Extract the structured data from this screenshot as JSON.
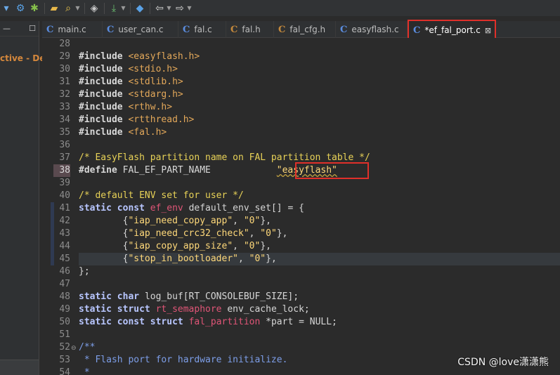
{
  "toolbar": {
    "icons": [
      "refresh-icon",
      "settings-icon",
      "debug-icon",
      "new-folder-icon",
      "search-icon",
      "layers-icon",
      "download-icon",
      "stack-icon",
      "back-icon",
      "forward-icon"
    ]
  },
  "left_panel": {
    "header_icons": [
      "minimize-icon",
      "maximize-icon"
    ],
    "project_label_fragment": "ctive - De"
  },
  "tabs": [
    {
      "label": "main.c",
      "icon": "C",
      "icon_color": "#5b8de0",
      "modified": false,
      "active": false
    },
    {
      "label": "user_can.c",
      "icon": "C",
      "icon_color": "#5b8de0",
      "modified": false,
      "active": false
    },
    {
      "label": "fal.c",
      "icon": "C",
      "icon_color": "#5b8de0",
      "modified": false,
      "active": false
    },
    {
      "label": "fal.h",
      "icon": "C",
      "icon_color": "#c58a3c",
      "modified": false,
      "active": false
    },
    {
      "label": "fal_cfg.h",
      "icon": "C",
      "icon_color": "#c58a3c",
      "modified": false,
      "active": false
    },
    {
      "label": "easyflash.c",
      "icon": "C",
      "icon_color": "#5b8de0",
      "modified": false,
      "active": false
    },
    {
      "label": "*ef_fal_port.c",
      "icon": "C",
      "icon_color": "#5b8de0",
      "modified": true,
      "active": true,
      "close": "⊠"
    }
  ],
  "editor": {
    "line_numbers": [
      "28",
      "29",
      "30",
      "31",
      "32",
      "33",
      "34",
      "35",
      "36",
      "37",
      "38",
      "39",
      "40",
      "41",
      "42",
      "43",
      "44",
      "45",
      "46",
      "47",
      "48",
      "49",
      "50",
      "51",
      "52",
      "53",
      "54"
    ],
    "current_line": "38",
    "code": {
      "l29_kw": "#include",
      "l29_hdr": "<easyflash.h>",
      "l30_kw": "#include",
      "l30_hdr": "<stdio.h>",
      "l31_kw": "#include",
      "l31_hdr": "<stdlib.h>",
      "l32_kw": "#include",
      "l32_hdr": "<stdarg.h>",
      "l33_kw": "#include",
      "l33_hdr": "<rthw.h>",
      "l34_kw": "#include",
      "l34_hdr": "<rtthread.h>",
      "l35_kw": "#include",
      "l35_hdr": "<fal.h>",
      "l37_cmt": "/* EasyFlash partition name on FAL partition table */",
      "l38_kw": "#define",
      "l38_name": "FAL_EF_PART_NAME",
      "l38_str": "\"easyflash\"",
      "l40_cmt": "/* default ENV set for user */",
      "l41_kw1": "static",
      "l41_kw2": "const",
      "l41_typ": "ef_env",
      "l41_rest": "default_env_set[] = {",
      "l42_str1": "\"iap_need_copy_app\"",
      "l42_str2": "\"0\"",
      "l43_str1": "\"iap_need_crc32_check\"",
      "l43_str2": "\"0\"",
      "l44_str1": "\"iap_copy_app_size\"",
      "l44_str2": "\"0\"",
      "l45_str1": "\"stop_in_bootloader\"",
      "l45_str2": "\"0\"",
      "l46": "};",
      "l48_kw1": "static",
      "l48_kw2": "char",
      "l48_rest": "log_buf[RT_CONSOLEBUF_SIZE];",
      "l49_kw1": "static",
      "l49_kw2": "struct",
      "l49_typ": "rt_semaphore",
      "l49_rest": "env_cache_lock;",
      "l50_kw1": "static",
      "l50_kw2": "const",
      "l50_kw3": "struct",
      "l50_typ": "fal_partition",
      "l50_rest": "*part = NULL;",
      "l52_doc": "/**",
      "l53_doc": " * Flash port for hardware initialize.",
      "l54_doc": " *"
    }
  },
  "watermark": "CSDN @love潇潇熊",
  "colors": {
    "annotation_red": "#e0302a",
    "keyword": "#b8c6ff",
    "string": "#ffd97a",
    "comment": "#e8d257",
    "type": "#e05577"
  }
}
